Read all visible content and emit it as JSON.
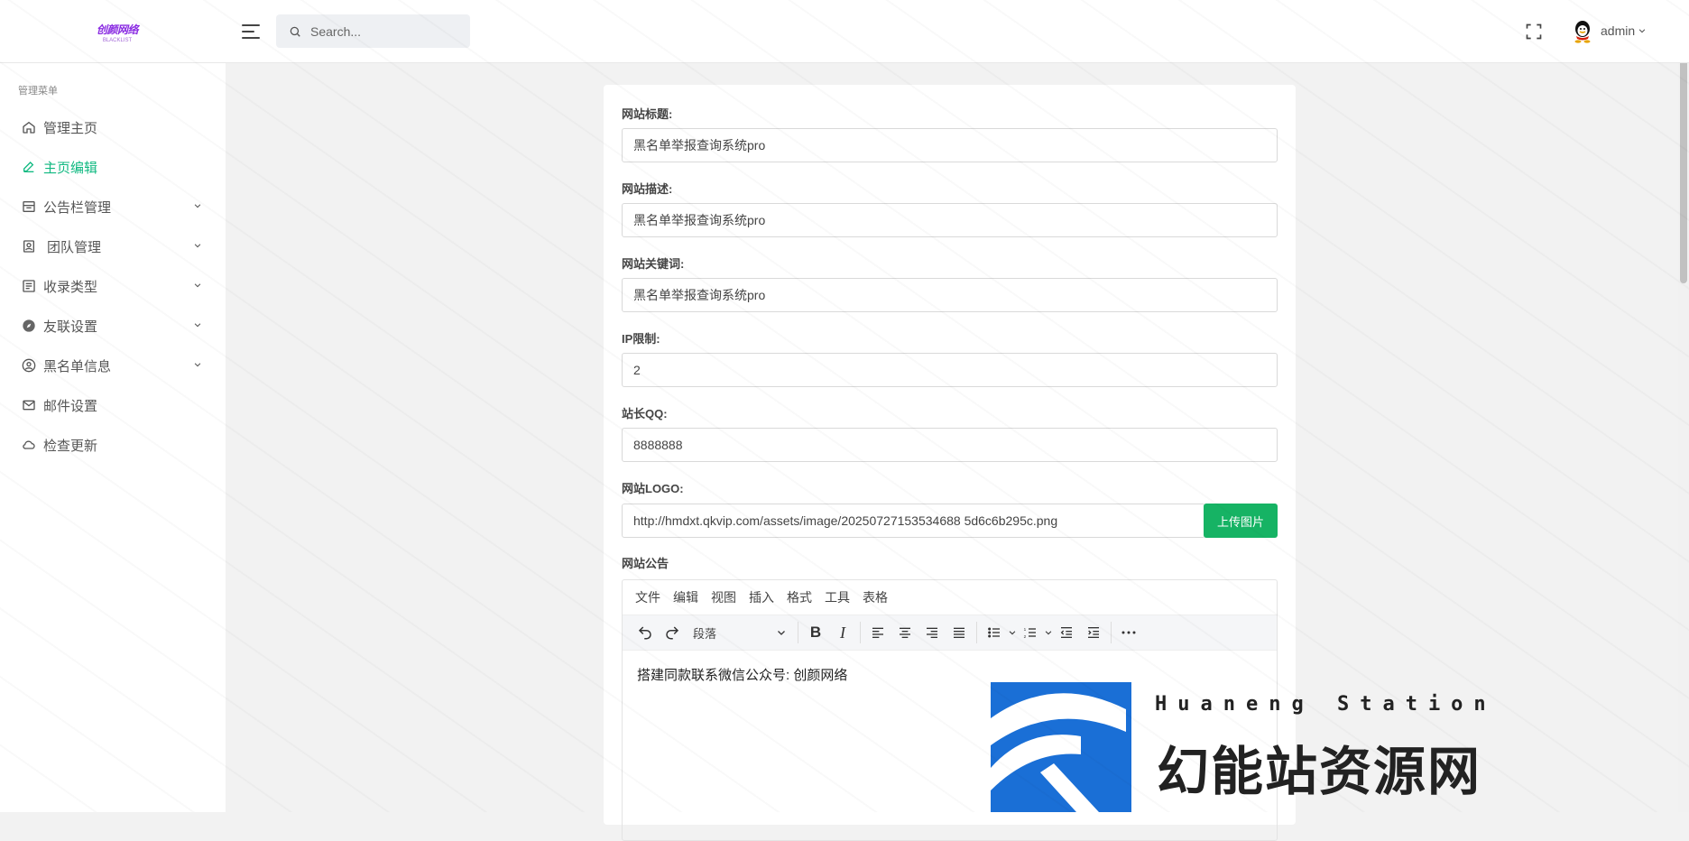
{
  "header": {
    "logo_text": "创颜网络",
    "logo_subtext": "BLACKLIST",
    "search_placeholder": "Search...",
    "user_name": "admin"
  },
  "sidebar": {
    "menu_title": "管理菜单",
    "items": [
      {
        "label": "管理主页",
        "icon": "home-icon",
        "active": false,
        "has_submenu": false
      },
      {
        "label": "主页编辑",
        "icon": "edit-icon",
        "active": true,
        "has_submenu": false
      },
      {
        "label": "公告栏管理",
        "icon": "bulletin-icon",
        "active": false,
        "has_submenu": true
      },
      {
        "label": "团队管理",
        "icon": "team-icon",
        "active": false,
        "has_submenu": true
      },
      {
        "label": "收录类型",
        "icon": "list-icon",
        "active": false,
        "has_submenu": true
      },
      {
        "label": "友联设置",
        "icon": "compass-icon",
        "active": false,
        "has_submenu": true
      },
      {
        "label": "黑名单信息",
        "icon": "user-icon",
        "active": false,
        "has_submenu": true
      },
      {
        "label": "邮件设置",
        "icon": "mail-icon",
        "active": false,
        "has_submenu": false
      },
      {
        "label": "检查更新",
        "icon": "cloud-icon",
        "active": false,
        "has_submenu": false
      }
    ]
  },
  "form": {
    "site_title": {
      "label": "网站标题:",
      "value": "黑名单举报查询系统pro"
    },
    "site_description": {
      "label": "网站描述:",
      "value": "黑名单举报查询系统pro"
    },
    "site_keywords": {
      "label": "网站关键词:",
      "value": "黑名单举报查询系统pro"
    },
    "ip_limit": {
      "label": "IP限制:",
      "value": "2"
    },
    "admin_qq": {
      "label": "站长QQ:",
      "value": "8888888"
    },
    "site_logo": {
      "label": "网站LOGO:",
      "value": "http://hmdxt.qkvip.com/assets/image/20250727153534688 5d6c6b295c.png",
      "upload_label": "上传图片"
    },
    "announcement": {
      "label": "网站公告"
    }
  },
  "editor": {
    "menus": [
      "文件",
      "编辑",
      "视图",
      "插入",
      "格式",
      "工具",
      "表格"
    ],
    "format_select": "段落",
    "content": "搭建同款联系微信公众号: 创颜网络"
  },
  "brand": {
    "en": "Huaneng Station",
    "cn": "幻能站资源网"
  },
  "colors": {
    "accent": "#10b981",
    "upload_button": "#16b364",
    "brand_blue": "#1a6fd6"
  }
}
